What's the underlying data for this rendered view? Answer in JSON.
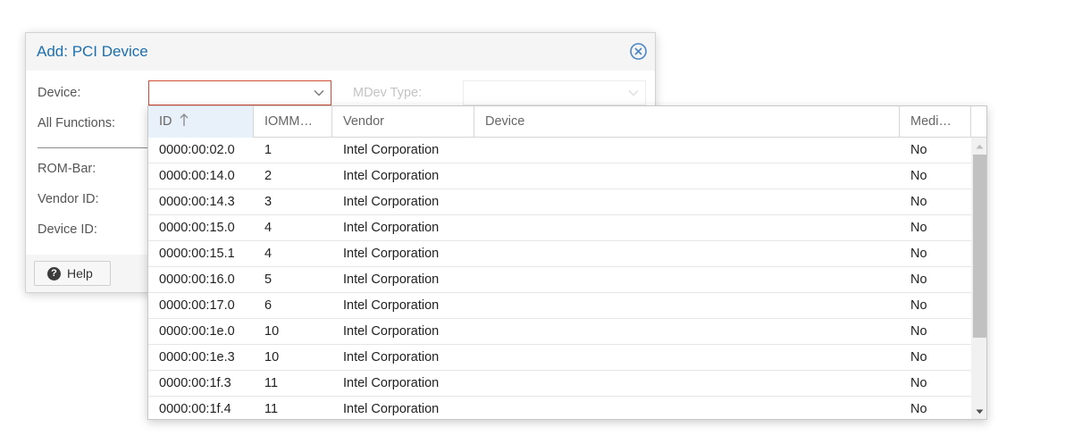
{
  "dialog": {
    "title": "Add: PCI Device",
    "close_icon": "close-circle-icon",
    "fields": {
      "device_label": "Device:",
      "device_value": "",
      "mdev_label": "MDev Type:",
      "all_functions_label": "All Functions:",
      "rom_bar_label": "ROM-Bar:",
      "vendor_id_label": "Vendor ID:",
      "device_id_label": "Device ID:"
    },
    "footer": {
      "help_label": "Help",
      "help_icon": "question-circle-icon"
    }
  },
  "picker": {
    "columns": [
      "ID",
      "IOMM…",
      "Vendor",
      "Device",
      "Medi…"
    ],
    "sort": {
      "column": "ID",
      "direction": "ascending",
      "icon": "arrow-up-icon"
    },
    "rows": [
      {
        "id": "0000:00:02.0",
        "iommu": "1",
        "vendor": "Intel Corporation",
        "device": "",
        "mdev": "No"
      },
      {
        "id": "0000:00:14.0",
        "iommu": "2",
        "vendor": "Intel Corporation",
        "device": "",
        "mdev": "No"
      },
      {
        "id": "0000:00:14.3",
        "iommu": "3",
        "vendor": "Intel Corporation",
        "device": "",
        "mdev": "No"
      },
      {
        "id": "0000:00:15.0",
        "iommu": "4",
        "vendor": "Intel Corporation",
        "device": "",
        "mdev": "No"
      },
      {
        "id": "0000:00:15.1",
        "iommu": "4",
        "vendor": "Intel Corporation",
        "device": "",
        "mdev": "No"
      },
      {
        "id": "0000:00:16.0",
        "iommu": "5",
        "vendor": "Intel Corporation",
        "device": "",
        "mdev": "No"
      },
      {
        "id": "0000:00:17.0",
        "iommu": "6",
        "vendor": "Intel Corporation",
        "device": "",
        "mdev": "No"
      },
      {
        "id": "0000:00:1e.0",
        "iommu": "10",
        "vendor": "Intel Corporation",
        "device": "",
        "mdev": "No"
      },
      {
        "id": "0000:00:1e.3",
        "iommu": "10",
        "vendor": "Intel Corporation",
        "device": "",
        "mdev": "No"
      },
      {
        "id": "0000:00:1f.3",
        "iommu": "11",
        "vendor": "Intel Corporation",
        "device": "",
        "mdev": "No"
      },
      {
        "id": "0000:00:1f.4",
        "iommu": "11",
        "vendor": "Intel Corporation",
        "device": "",
        "mdev": "No"
      }
    ]
  },
  "colors": {
    "title": "#1c6fad",
    "invalid_border": "#cf4c35",
    "sorted_header": "#e8f1f9"
  }
}
